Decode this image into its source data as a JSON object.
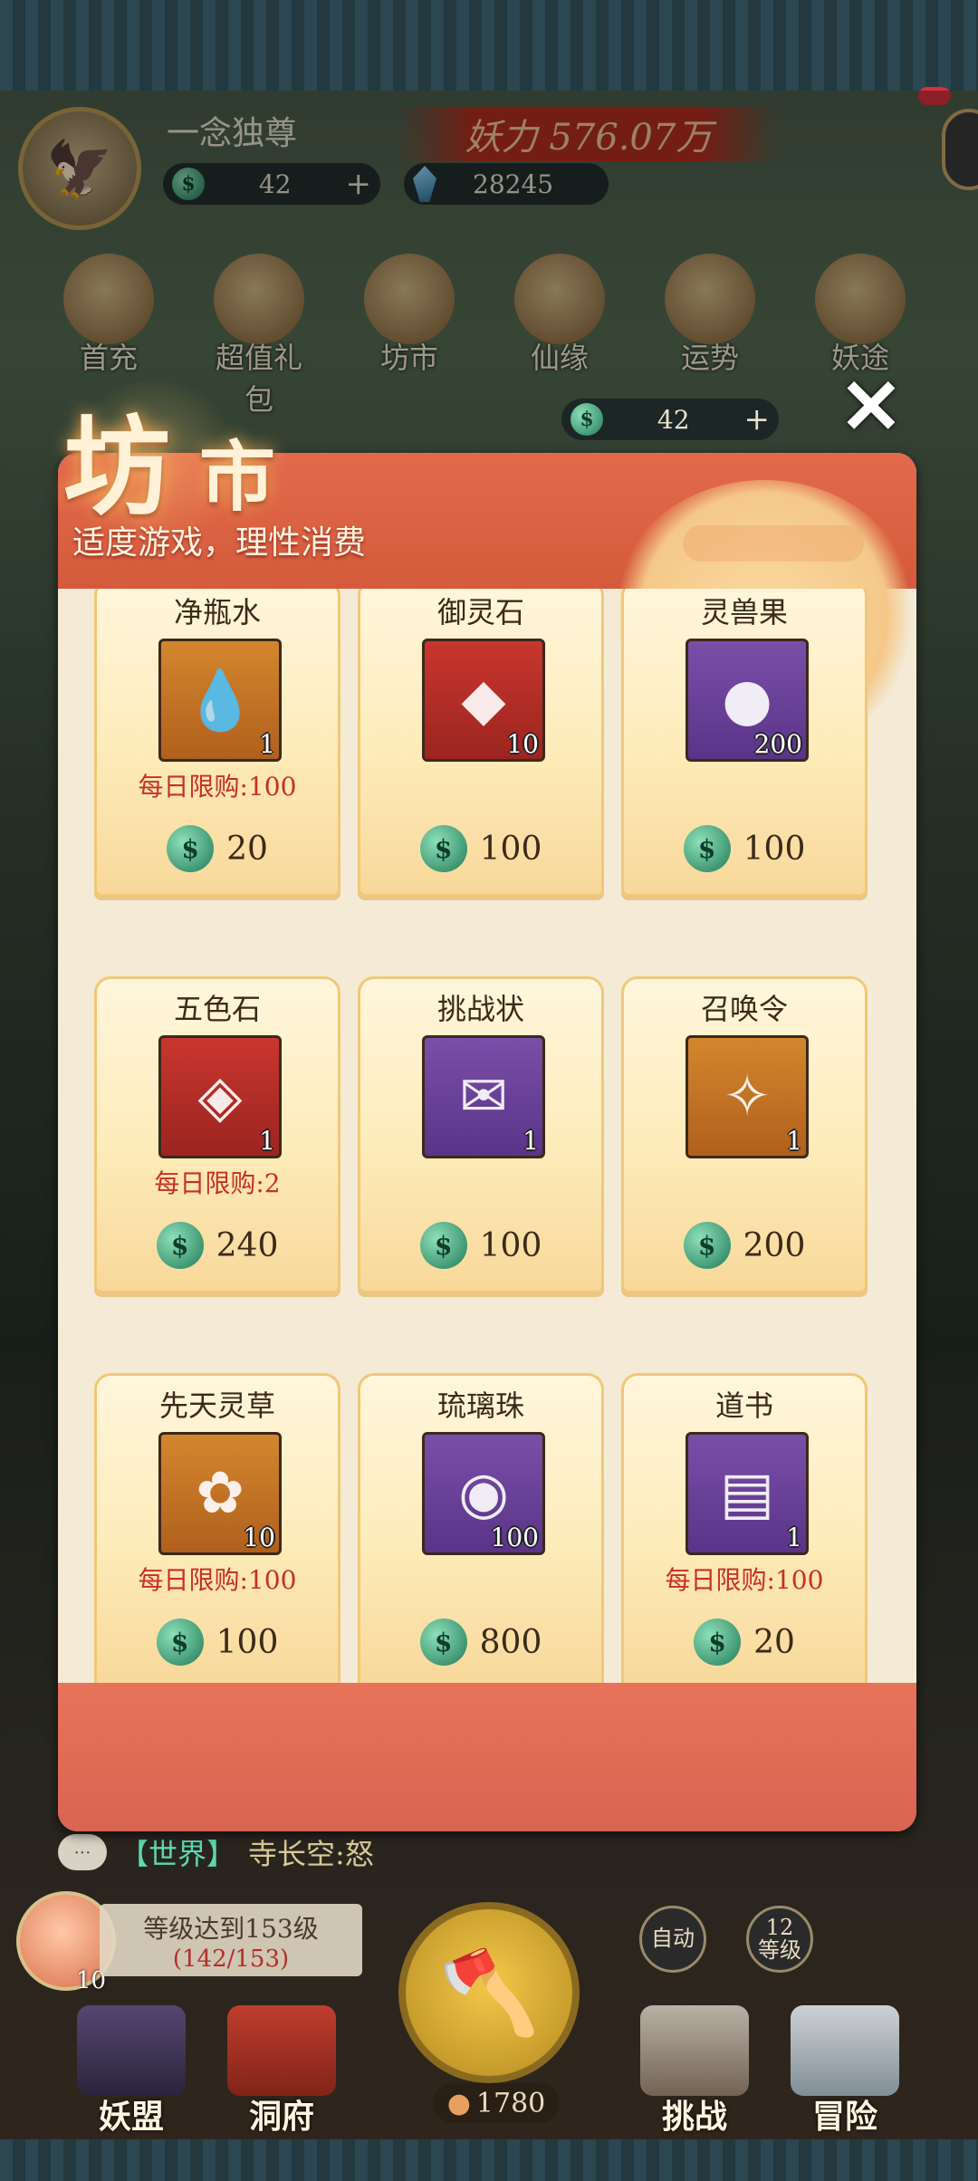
{
  "player": {
    "name": "一念独尊",
    "power": "妖力 576.07万",
    "jade": "42",
    "crystal": "28245",
    "avatar_icon": "eagle-icon"
  },
  "top_menu": [
    {
      "label": "首充",
      "icon": "first-charge-icon"
    },
    {
      "label": "超值礼包",
      "icon": "gift-pack-icon"
    },
    {
      "label": "坊市",
      "icon": "coin-icon"
    },
    {
      "label": "仙缘",
      "icon": "lotus-icon"
    },
    {
      "label": "运势",
      "icon": "fortune-icon"
    },
    {
      "label": "妖途",
      "icon": "book-icon"
    }
  ],
  "shop": {
    "title_part1": "坊",
    "title_part2": "市",
    "subtitle": "适度游戏，理性消费",
    "currency": "42",
    "close_symbol": "✕",
    "items": [
      {
        "name": "净瓶水",
        "qty": "1",
        "limit": "每日限购:100",
        "price": "20",
        "frame": "orange",
        "glyph": "💧",
        "icon": "water-bottle-icon"
      },
      {
        "name": "御灵石",
        "qty": "10",
        "limit": "",
        "price": "100",
        "frame": "red",
        "glyph": "◆",
        "icon": "spirit-stone-icon"
      },
      {
        "name": "灵兽果",
        "qty": "200",
        "limit": "",
        "price": "100",
        "frame": "purple",
        "glyph": "●",
        "icon": "beast-fruit-icon"
      },
      {
        "name": "五色石",
        "qty": "1",
        "limit": "每日限购:2",
        "price": "240",
        "frame": "red",
        "glyph": "◈",
        "icon": "five-color-stone-icon"
      },
      {
        "name": "挑战状",
        "qty": "1",
        "limit": "",
        "price": "100",
        "frame": "purple",
        "glyph": "✉",
        "icon": "challenge-scroll-icon"
      },
      {
        "name": "召唤令",
        "qty": "1",
        "limit": "",
        "price": "200",
        "frame": "orange",
        "glyph": "✧",
        "icon": "summon-token-icon"
      },
      {
        "name": "先天灵草",
        "qty": "10",
        "limit": "每日限购:100",
        "price": "100",
        "frame": "orange",
        "glyph": "✿",
        "icon": "spirit-herb-icon"
      },
      {
        "name": "琉璃珠",
        "qty": "100",
        "limit": "",
        "price": "800",
        "frame": "purple",
        "glyph": "◉",
        "icon": "glass-pearl-icon"
      },
      {
        "name": "道书",
        "qty": "1",
        "limit": "每日限购:100",
        "price": "20",
        "frame": "purple",
        "glyph": "▤",
        "icon": "dao-book-icon"
      }
    ]
  },
  "chat": {
    "channel": "【世界】",
    "message": "寺长空:怒",
    "bubble": "···"
  },
  "level": {
    "peach_count": "10",
    "goal": "等级达到153级",
    "progress": "(142/153)"
  },
  "buttons": {
    "auto": "自动",
    "level_num": "12",
    "level_label": "等级",
    "coin_count": "1780"
  },
  "bottom_nav": [
    {
      "label": "妖盟",
      "icon": "alliance-icon"
    },
    {
      "label": "洞府",
      "icon": "cave-icon"
    },
    {
      "label": "挑战",
      "icon": "challenge-icon"
    },
    {
      "label": "冒险",
      "icon": "adventure-icon"
    }
  ],
  "colors": {
    "accent_red": "#d55a3c",
    "card_bg": "#fdebb9",
    "limit_red": "#c62f2a",
    "jade_green": "#1f7a57"
  }
}
